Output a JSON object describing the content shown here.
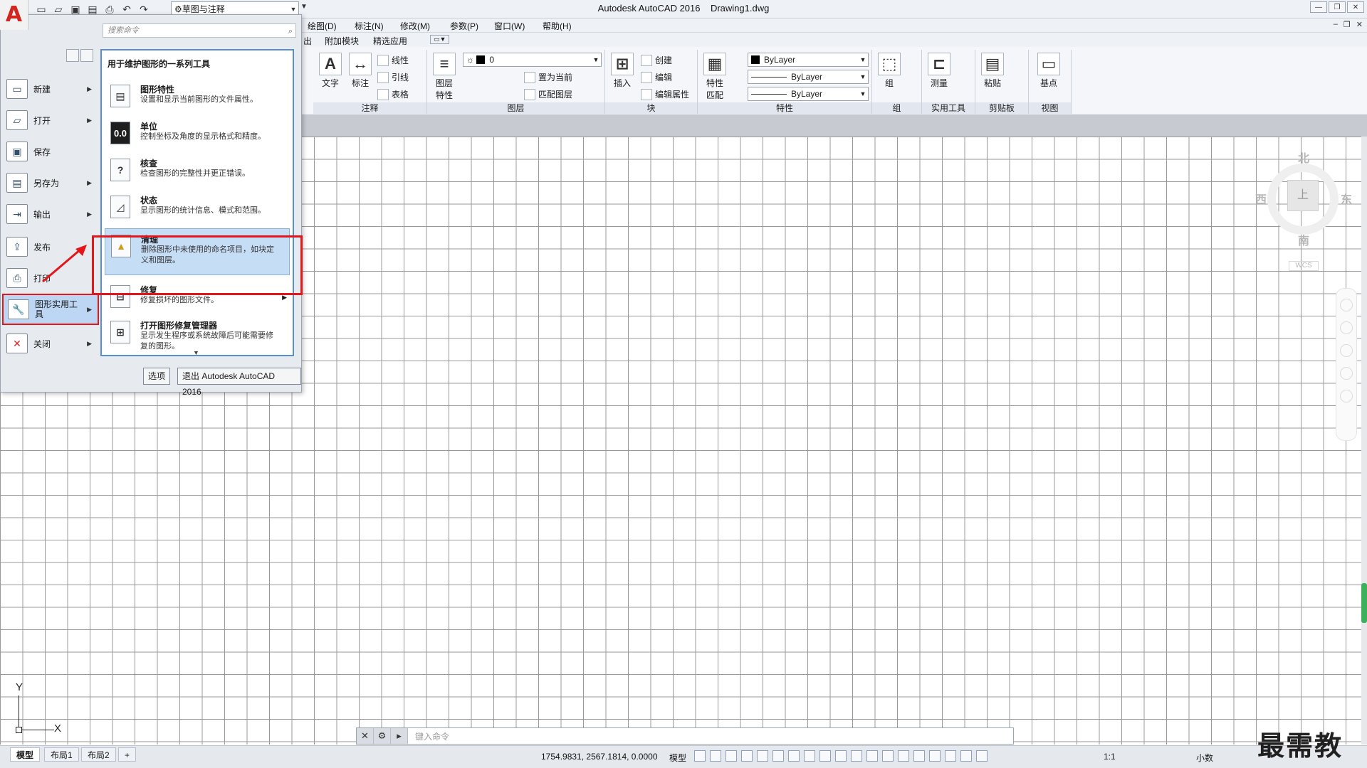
{
  "titlebar": {
    "app_title": "Autodesk AutoCAD 2016",
    "doc_title": "Drawing1.dwg",
    "workspace": "草图与注释"
  },
  "menubar": {
    "items": [
      "绘图(D)",
      "标注(N)",
      "修改(M)",
      "参数(P)",
      "窗口(W)",
      "帮助(H)"
    ]
  },
  "ribbon_tabs": {
    "items": [
      "出",
      "附加模块",
      "精选应用"
    ]
  },
  "ribbon": {
    "annotation": {
      "title": "注释",
      "text_btn": "文字",
      "dim_btn": "标注",
      "linear": "线性",
      "leader": "引线",
      "table": "表格"
    },
    "layers": {
      "title": "图层",
      "props_btn": "图层\n特性",
      "layer_combo": "0",
      "set_current": "置为当前",
      "match_layer": "匹配图层"
    },
    "block": {
      "title": "块",
      "insert": "插入",
      "create": "创建",
      "edit": "编辑",
      "edit_attr": "编辑属性"
    },
    "properties": {
      "title": "特性",
      "match_btn": "特性\n匹配",
      "color": "ByLayer",
      "linetype": "ByLayer",
      "lineweight": "ByLayer"
    },
    "group": {
      "title": "组",
      "btn": "组"
    },
    "utilities": {
      "title": "实用工具",
      "measure": "测量"
    },
    "clipboard": {
      "title": "剪贴板",
      "paste": "粘贴"
    },
    "view": {
      "title": "视图",
      "base": "基点"
    }
  },
  "viewcube": {
    "north": "北",
    "south": "南",
    "east": "东",
    "west": "西",
    "face": "上",
    "wcs": "WCS"
  },
  "ucs": {
    "y": "Y",
    "x": "X"
  },
  "cmdline": {
    "placeholder": "键入命令"
  },
  "statusbar": {
    "tabs": [
      "模型",
      "布局1",
      "布局2"
    ],
    "coords": "1754.9831, 2567.1814, 0.0000",
    "model": "模型",
    "scale": "1:1",
    "units": "小数"
  },
  "appmenu": {
    "search_placeholder": "搜索命令",
    "left_items": [
      {
        "label": "新建",
        "icon": "new-icon",
        "arrow": true
      },
      {
        "label": "打开",
        "icon": "open-icon",
        "arrow": true
      },
      {
        "label": "保存",
        "icon": "save-icon",
        "arrow": false
      },
      {
        "label": "另存为",
        "icon": "save-as-icon",
        "arrow": true
      },
      {
        "label": "输出",
        "icon": "export-icon",
        "arrow": true
      },
      {
        "label": "发布",
        "icon": "publish-icon",
        "arrow": false
      },
      {
        "label": "打印",
        "icon": "print-icon",
        "arrow": false
      },
      {
        "label": "图形实用工\n具",
        "icon": "drawing-utilities-icon",
        "arrow": true,
        "selected": true
      },
      {
        "label": "关闭",
        "icon": "close-doc-icon",
        "arrow": true
      }
    ],
    "right_header": "用于维护图形的一系列工具",
    "right_items": [
      {
        "title": "图形特性",
        "desc": "设置和显示当前图形的文件属性。",
        "icon_text": ""
      },
      {
        "title": "单位",
        "desc": "控制坐标及角度的显示格式和精度。",
        "icon_text": "0.0"
      },
      {
        "title": "核查",
        "desc": "检查图形的完整性并更正错误。",
        "icon_text": "?"
      },
      {
        "title": "状态",
        "desc": "显示图形的统计信息、模式和范围。",
        "icon_text": ""
      },
      {
        "title": "清理",
        "desc": "删除图形中未使用的命名项目，如块定义和图层。",
        "icon_text": "",
        "highlighted": true
      },
      {
        "title": "修复",
        "desc": "修复损坏的图形文件。",
        "icon_text": "",
        "submenu": true
      },
      {
        "title": "打开图形修复管理器",
        "desc": "显示发生程序或系统故障后可能需要修复的图形。",
        "icon_text": ""
      }
    ],
    "options_btn": "选项",
    "exit_btn": "退出 Autodesk AutoCAD 2016"
  },
  "watermark": "最需教育"
}
